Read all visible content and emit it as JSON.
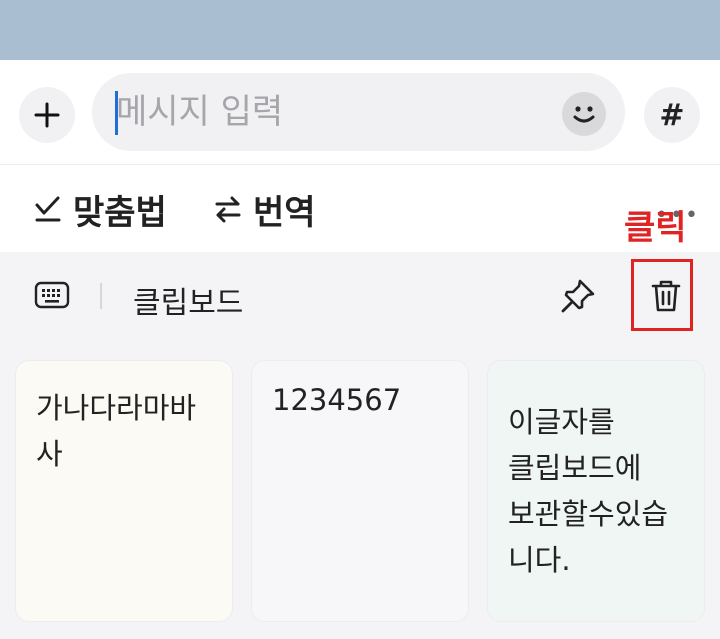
{
  "compose": {
    "placeholder": "메시지 입력",
    "hash_label": "#"
  },
  "tools": {
    "spell_label": "맞춤법",
    "translate_label": "번역"
  },
  "clipboard": {
    "title": "클립보드",
    "items": [
      "가나다라마바\n사",
      "1234567",
      "이글자를\n클립보드에\n보관할수있습\n니다."
    ]
  },
  "annotation": {
    "label": "클릭",
    "color": "#e02424"
  },
  "colors": {
    "top_band": "#a9bfd1",
    "caret": "#1f6fd6"
  },
  "icons": [
    "plus-icon",
    "smile-icon",
    "hash-icon",
    "check-icon",
    "swap-arrows-icon",
    "more-icon",
    "keyboard-icon",
    "pin-icon",
    "trash-icon"
  ]
}
